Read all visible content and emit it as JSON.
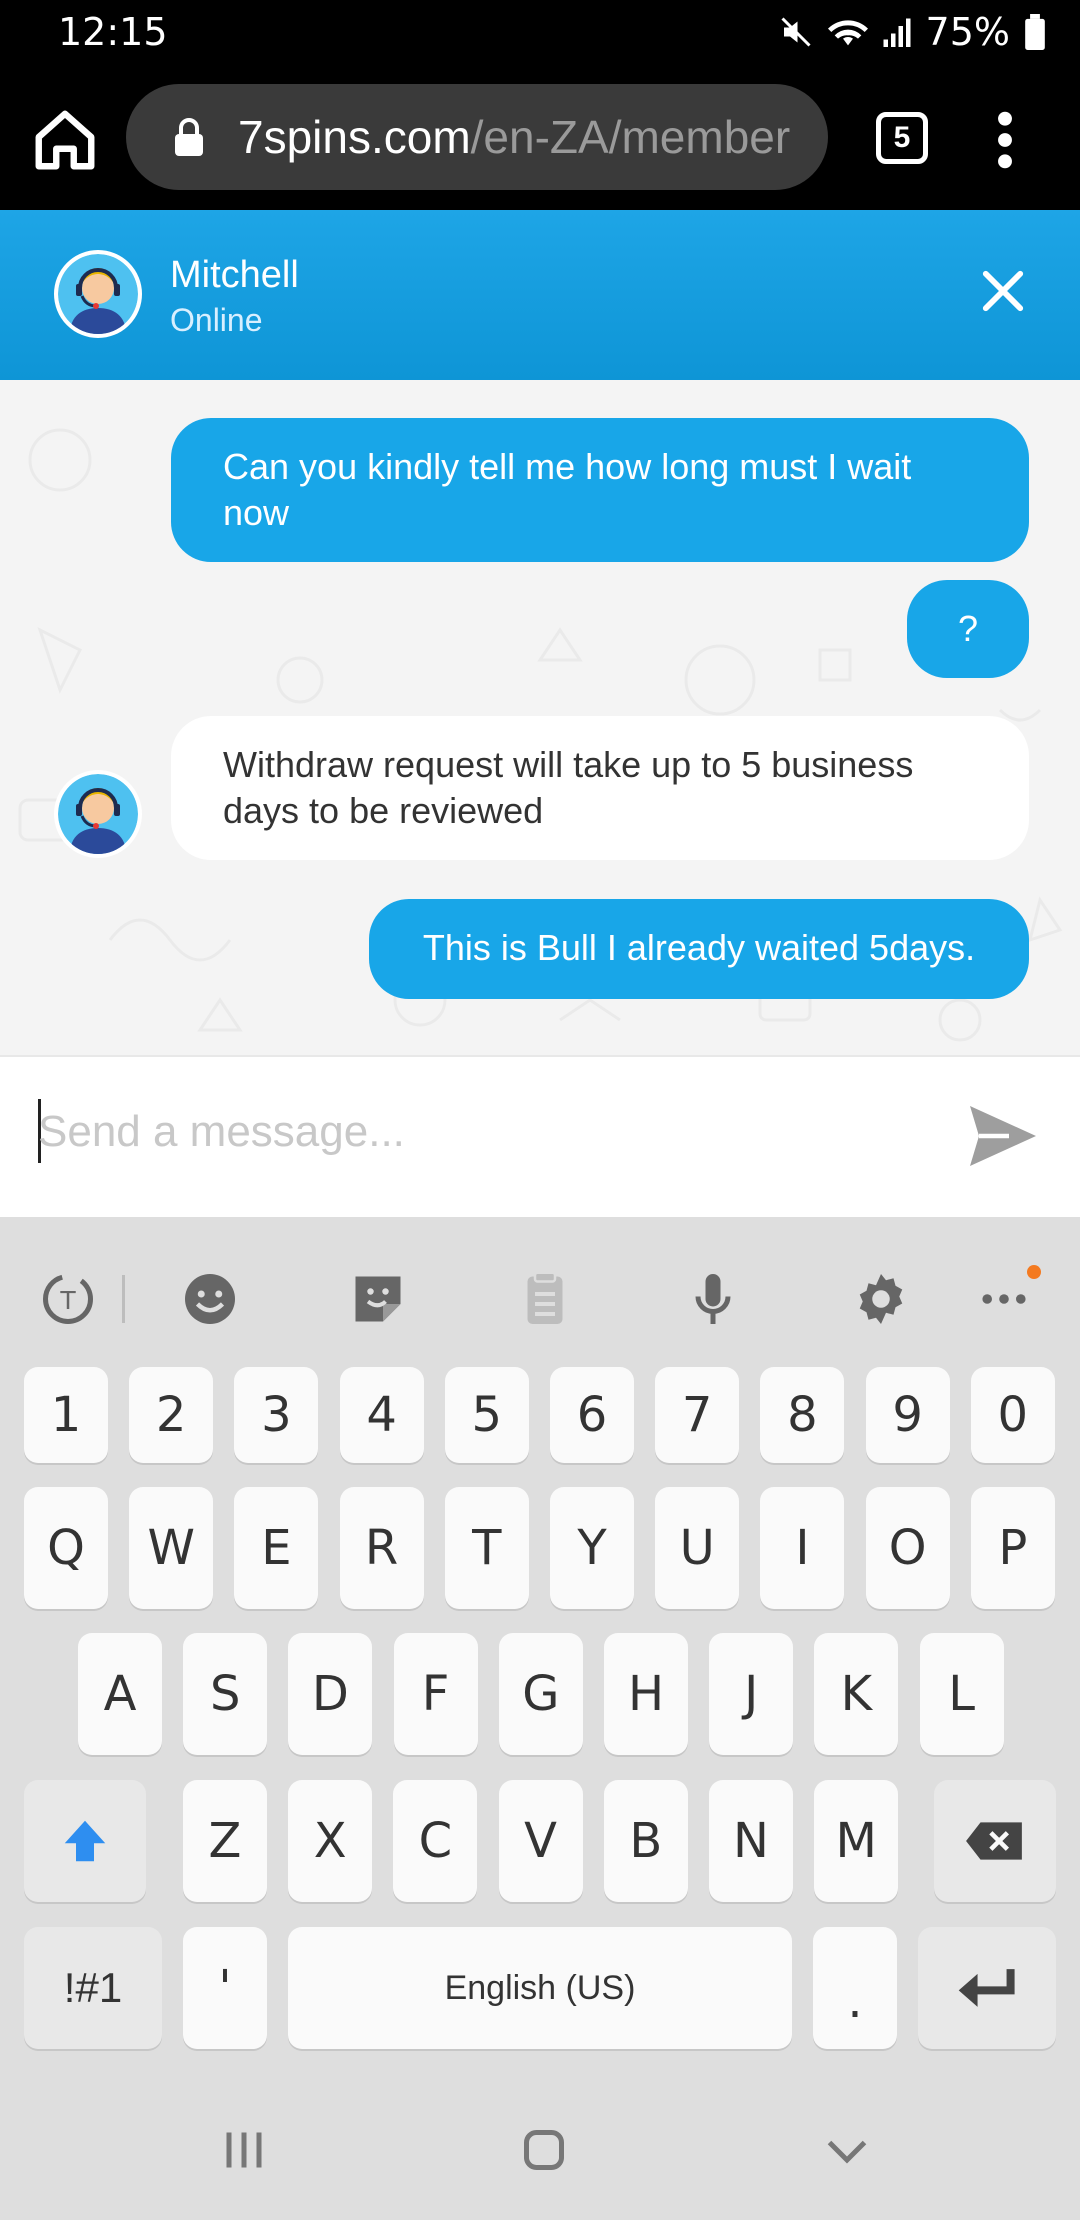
{
  "status_bar": {
    "time": "12:15",
    "battery": "75%"
  },
  "browser": {
    "url_host": "7spins.com",
    "url_path": "/en-ZA/member",
    "tab_count": "5"
  },
  "chat": {
    "agent_name": "Mitchell",
    "agent_status": "Online",
    "messages": [
      {
        "from": "user",
        "text": "Can you kindly tell me how long must I wait now"
      },
      {
        "from": "user",
        "text": "?"
      },
      {
        "from": "agent",
        "text": "Withdraw request will take up to 5 business days to be reviewed"
      },
      {
        "from": "user",
        "text": "This is Bull I already waited 5days."
      }
    ],
    "input_placeholder": "Send a message..."
  },
  "keyboard": {
    "number_row": [
      "1",
      "2",
      "3",
      "4",
      "5",
      "6",
      "7",
      "8",
      "9",
      "0"
    ],
    "row1": [
      "Q",
      "W",
      "E",
      "R",
      "T",
      "Y",
      "U",
      "I",
      "O",
      "P"
    ],
    "row2": [
      "A",
      "S",
      "D",
      "F",
      "G",
      "H",
      "J",
      "K",
      "L"
    ],
    "row3": [
      "Z",
      "X",
      "C",
      "V",
      "B",
      "N",
      "M"
    ],
    "symbols_label": "!#1",
    "apostrophe": "'",
    "space_label": "English (US)",
    "period": ".",
    "accent_color": "#2e8ef0"
  },
  "colors": {
    "chat_header": "#1ea5e6",
    "user_bubble": "#18a6e8",
    "notification_dot": "#f47a20"
  }
}
